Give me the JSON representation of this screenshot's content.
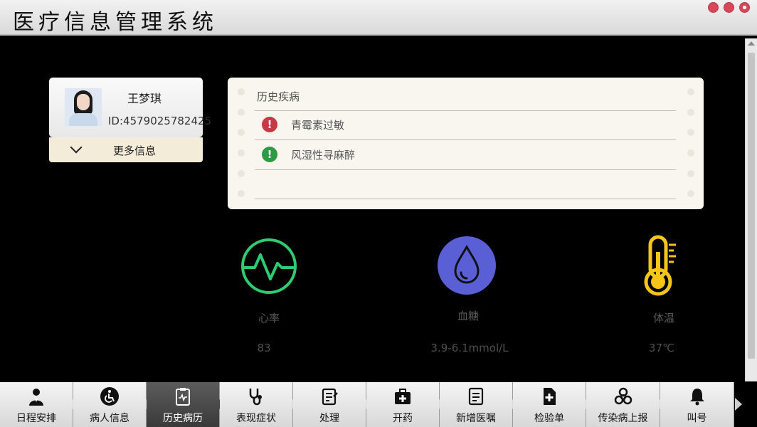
{
  "app": {
    "title": "医疗信息管理系统"
  },
  "patient": {
    "name": "王梦琪",
    "id_text": "ID:4579025782425",
    "more_info": "更多信息"
  },
  "history": {
    "heading": "历史疾病",
    "items": [
      {
        "text": "青霉素过敏",
        "icon": "red-exclamation-icon",
        "color": "#c63a45"
      },
      {
        "text": "风湿性寻麻醉",
        "icon": "green-exclamation-icon",
        "color": "#2f9a45"
      }
    ]
  },
  "vitals": {
    "heart_rate": {
      "label": "心率",
      "value": "83",
      "icon": "heartbeat-icon",
      "color": "#2ecc71"
    },
    "blood_sugar": {
      "label": "血糖",
      "value": "3.9-6.1mmol/L",
      "icon": "blood-drop-icon",
      "color": "#5b5fd6"
    },
    "temperature": {
      "label": "体温",
      "value": "37℃",
      "icon": "thermometer-icon",
      "color": "#f5c518"
    }
  },
  "nav": {
    "items": [
      {
        "label": "日程安排",
        "icon": "doctor-icon"
      },
      {
        "label": "病人信息",
        "icon": "wheelchair-icon"
      },
      {
        "label": "历史病历",
        "icon": "clipboard-pulse-icon",
        "active": true
      },
      {
        "label": "表现症状",
        "icon": "stethoscope-icon"
      },
      {
        "label": "处理",
        "icon": "notepad-icon"
      },
      {
        "label": "开药",
        "icon": "medkit-icon"
      },
      {
        "label": "新增医嘱",
        "icon": "notes-icon"
      },
      {
        "label": "检验单",
        "icon": "file-plus-icon"
      },
      {
        "label": "传染病上报",
        "icon": "biohazard-icon"
      },
      {
        "label": "叫号",
        "icon": "bell-icon"
      }
    ]
  }
}
